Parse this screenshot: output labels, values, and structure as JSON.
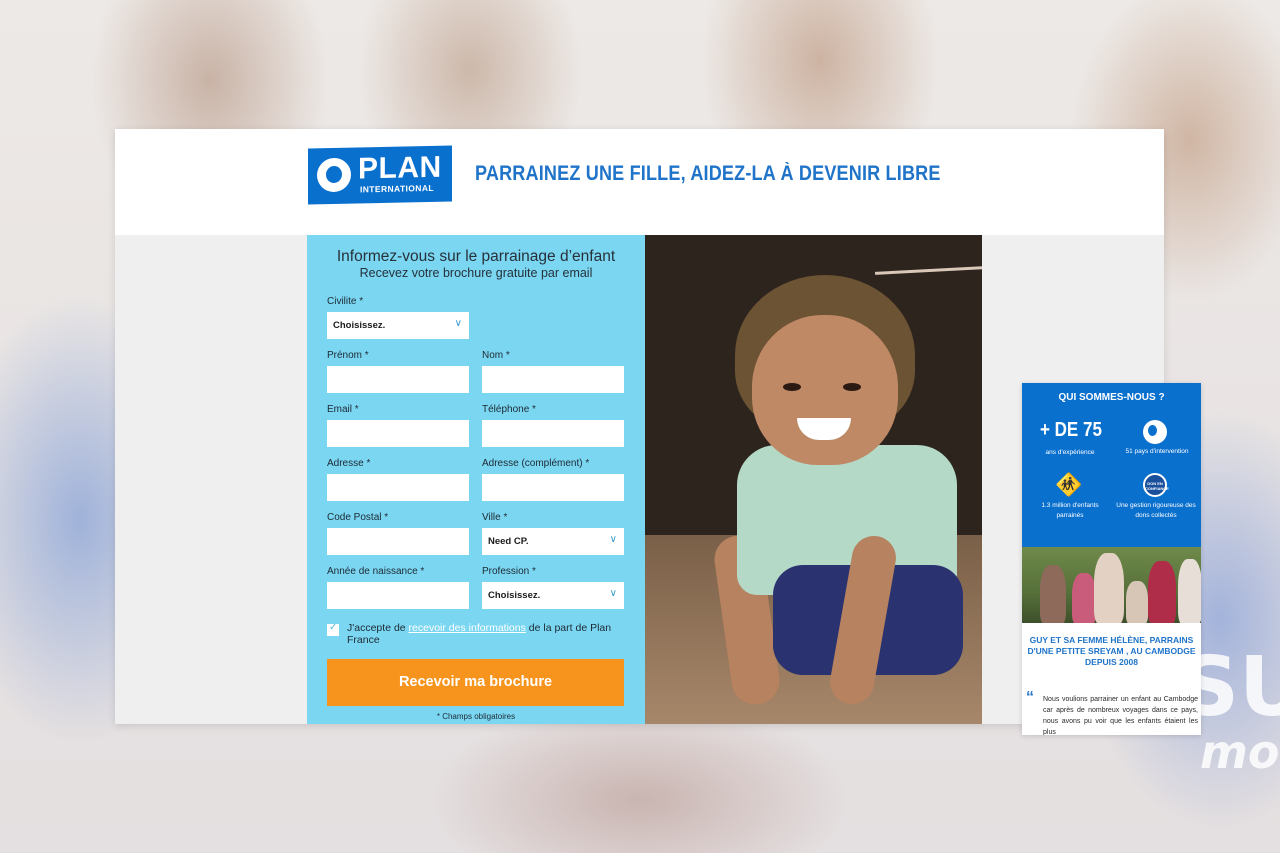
{
  "header": {
    "logo_top": "PLAN",
    "logo_bottom": "INTERNATIONAL",
    "headline": "PARRAINEZ UNE FILLE, AIDEZ-LA À DEVENIR LIBRE"
  },
  "form": {
    "title": "Informez-vous sur le parrainage d’enfant",
    "subtitle": "Recevez votre brochure gratuite par email",
    "civilite": {
      "label": "Civilite *",
      "value": "Choisissez."
    },
    "prenom": {
      "label": "Prénom *",
      "value": ""
    },
    "nom": {
      "label": "Nom *",
      "value": ""
    },
    "email": {
      "label": "Email *",
      "value": ""
    },
    "telephone": {
      "label": "Téléphone *",
      "value": ""
    },
    "adresse": {
      "label": "Adresse *",
      "value": ""
    },
    "adresse_complement": {
      "label": "Adresse (complément) *",
      "value": ""
    },
    "code_postal": {
      "label": "Code Postal *",
      "value": ""
    },
    "ville": {
      "label": "Ville *",
      "value": "Need CP."
    },
    "annee_naissance": {
      "label": "Année de naissance *",
      "value": ""
    },
    "profession": {
      "label": "Profession *",
      "value": "Choisissez."
    },
    "consent": {
      "checked": true,
      "before": "J'accepte de ",
      "link": "recevoir des informations",
      "after": " de la part de Plan France"
    },
    "submit_label": "Recevoir ma brochure",
    "required_note": "* Champs obligatoires"
  },
  "side": {
    "title": "QUI SOMMES-NOUS ?",
    "stat_years": "+ DE 75",
    "stat_years_caption": "ans d'expérience",
    "stat_countries_caption": "51 pays d'intervention",
    "stat_children_caption": "1.3 million d'enfants parrainés",
    "stat_badge_text": "DON EN CONFIANCE",
    "stat_gestion_caption": "Une gestion rigoureuse des dons collectés",
    "quote_title": "GUY ET SA FEMME HÉLÈNE, PARRAINS D'UNE PETITE SREYAM , AU CAMBODGE DEPUIS 2008",
    "quote_text": "Nous voulions parrainer un enfant au Cambodge car après de nombreux voyages dans ce pays, nous avons pu voir que les enfants étaient les plus"
  },
  "background_text": {
    "line1": "SU",
    "line2": "mo"
  },
  "colors": {
    "brand_blue": "#0a70ce",
    "form_bg": "#7bd6f2",
    "cta_orange": "#f7941d"
  },
  "icons": [
    "chevron-down-icon",
    "checkbox-check-icon",
    "globe-icon",
    "children-icon",
    "don-en-confiance-badge-icon",
    "quote-icon"
  ]
}
